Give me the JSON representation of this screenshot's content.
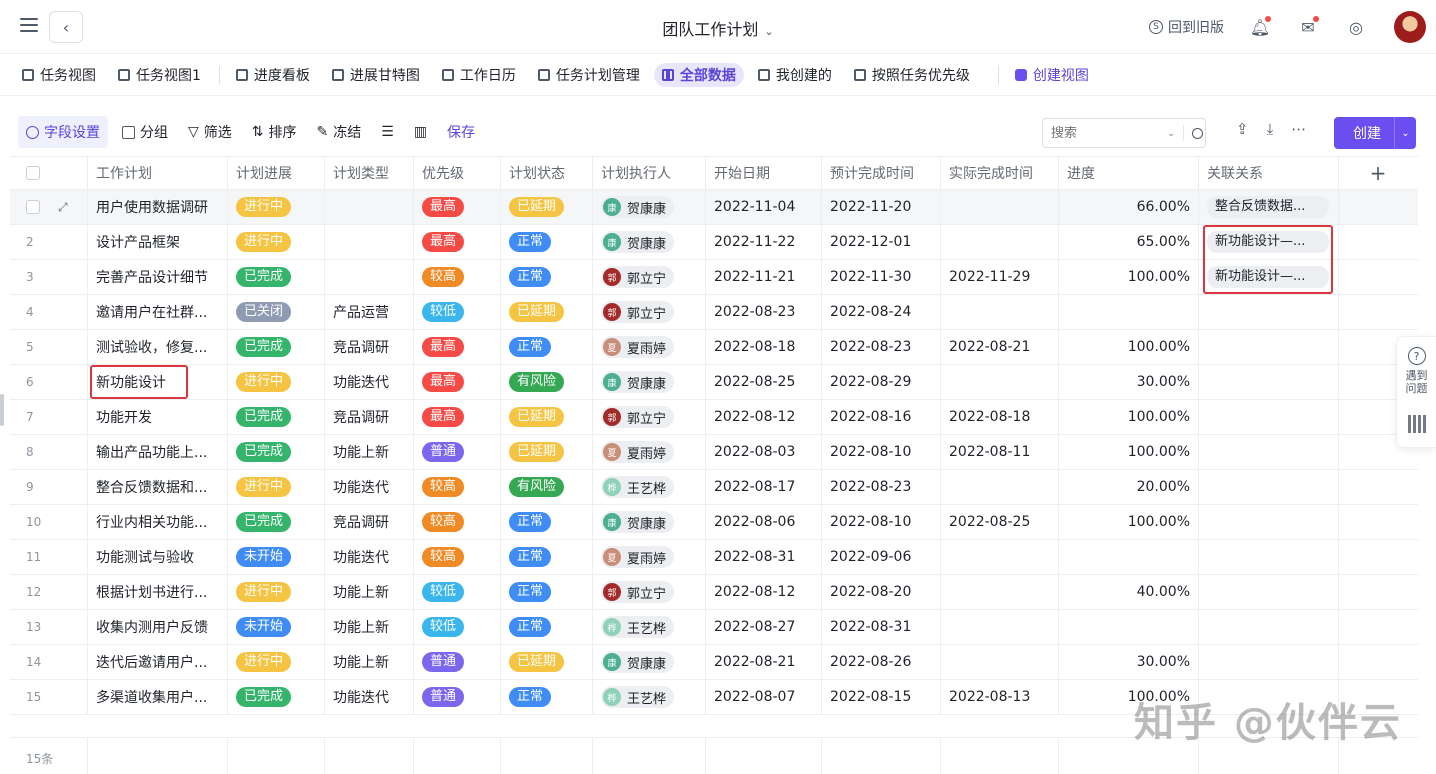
{
  "header": {
    "title": "团队工作计划",
    "old_version": "回到旧版"
  },
  "views": [
    {
      "label": "任务视图"
    },
    {
      "label": "任务视图1"
    },
    {
      "label": "进度看板"
    },
    {
      "label": "进展甘特图"
    },
    {
      "label": "工作日历"
    },
    {
      "label": "任务计划管理"
    },
    {
      "label": "全部数据",
      "active": true
    },
    {
      "label": "我创建的"
    },
    {
      "label": "按照任务优先级"
    }
  ],
  "create_view": "创建视图",
  "toolbar": {
    "field_settings": "字段设置",
    "group": "分组",
    "filter": "筛选",
    "sort": "排序",
    "freeze": "冻结",
    "save": "保存",
    "search_placeholder": "搜索",
    "create": "创建"
  },
  "columns": [
    "工作计划",
    "计划进展",
    "计划类型",
    "优先级",
    "计划状态",
    "计划执行人",
    "开始日期",
    "预计完成时间",
    "实际完成时间",
    "进度",
    "关联关系"
  ],
  "colors": {
    "进行中": "#f5c443",
    "已完成": "#34b56b",
    "已关闭": "#8f9bb3",
    "未开始": "#3f8cf5",
    "最高": "#f54a45",
    "较高": "#f08a24",
    "较低": "#3ab6ec",
    "普通": "#7b67ee",
    "已延期": "#f5c443",
    "正常": "#3f8cf5",
    "有风险": "#34a853",
    "accent": "#6b4ef0"
  },
  "people": {
    "贺康康": {
      "initial": "康",
      "color": "#4caf8f"
    },
    "郭立宁": {
      "initial": "郭",
      "color": "#a52a2a"
    },
    "夏雨婷": {
      "initial": "夏",
      "color": "#c98e7a"
    },
    "王艺桦": {
      "initial": "桦",
      "color": "#8fd1b9"
    }
  },
  "rows": [
    {
      "num": "",
      "name": "用户使用数据调研",
      "progress": "进行中",
      "type": "",
      "priority": "最高",
      "status": "已延期",
      "owner": "贺康康",
      "start": "2022-11-04",
      "due": "2022-11-20",
      "done": "",
      "pct": "66.00%",
      "rel": "整合反馈数据..."
    },
    {
      "num": "2",
      "name": "设计产品框架",
      "progress": "进行中",
      "type": "",
      "priority": "最高",
      "status": "正常",
      "owner": "贺康康",
      "start": "2022-11-22",
      "due": "2022-12-01",
      "done": "",
      "pct": "65.00%",
      "rel": "新功能设计—..."
    },
    {
      "num": "3",
      "name": "完善产品设计细节",
      "progress": "已完成",
      "type": "",
      "priority": "较高",
      "status": "正常",
      "owner": "郭立宁",
      "start": "2022-11-21",
      "due": "2022-11-30",
      "done": "2022-11-29",
      "pct": "100.00%",
      "rel": "新功能设计—..."
    },
    {
      "num": "4",
      "name": "邀请用户在社群...",
      "progress": "已关闭",
      "type": "产品运营",
      "priority": "较低",
      "status": "已延期",
      "owner": "郭立宁",
      "start": "2022-08-23",
      "due": "2022-08-24",
      "done": "",
      "pct": "",
      "rel": ""
    },
    {
      "num": "5",
      "name": "测试验收，修复...",
      "progress": "已完成",
      "type": "竞品调研",
      "priority": "最高",
      "status": "正常",
      "owner": "夏雨婷",
      "start": "2022-08-18",
      "due": "2022-08-23",
      "done": "2022-08-21",
      "pct": "100.00%",
      "rel": ""
    },
    {
      "num": "6",
      "name": "新功能设计",
      "progress": "进行中",
      "type": "功能迭代",
      "priority": "最高",
      "status": "有风险",
      "owner": "贺康康",
      "start": "2022-08-25",
      "due": "2022-08-29",
      "done": "",
      "pct": "30.00%",
      "rel": ""
    },
    {
      "num": "7",
      "name": "功能开发",
      "progress": "已完成",
      "type": "竞品调研",
      "priority": "最高",
      "status": "已延期",
      "owner": "郭立宁",
      "start": "2022-08-12",
      "due": "2022-08-16",
      "done": "2022-08-18",
      "pct": "100.00%",
      "rel": ""
    },
    {
      "num": "8",
      "name": "输出产品功能上...",
      "progress": "已完成",
      "type": "功能上新",
      "priority": "普通",
      "status": "已延期",
      "owner": "夏雨婷",
      "start": "2022-08-03",
      "due": "2022-08-10",
      "done": "2022-08-11",
      "pct": "100.00%",
      "rel": ""
    },
    {
      "num": "9",
      "name": "整合反馈数据和...",
      "progress": "进行中",
      "type": "功能迭代",
      "priority": "较高",
      "status": "有风险",
      "owner": "王艺桦",
      "start": "2022-08-17",
      "due": "2022-08-23",
      "done": "",
      "pct": "20.00%",
      "rel": ""
    },
    {
      "num": "10",
      "name": "行业内相关功能...",
      "progress": "已完成",
      "type": "竞品调研",
      "priority": "较高",
      "status": "正常",
      "owner": "贺康康",
      "start": "2022-08-06",
      "due": "2022-08-10",
      "done": "2022-08-25",
      "pct": "100.00%",
      "rel": ""
    },
    {
      "num": "11",
      "name": "功能测试与验收",
      "progress": "未开始",
      "type": "功能迭代",
      "priority": "较高",
      "status": "正常",
      "owner": "夏雨婷",
      "start": "2022-08-31",
      "due": "2022-09-06",
      "done": "",
      "pct": "",
      "rel": ""
    },
    {
      "num": "12",
      "name": "根据计划书进行...",
      "progress": "进行中",
      "type": "功能上新",
      "priority": "较低",
      "status": "正常",
      "owner": "郭立宁",
      "start": "2022-08-12",
      "due": "2022-08-20",
      "done": "",
      "pct": "40.00%",
      "rel": ""
    },
    {
      "num": "13",
      "name": "收集内测用户反馈",
      "progress": "未开始",
      "type": "功能上新",
      "priority": "较低",
      "status": "正常",
      "owner": "王艺桦",
      "start": "2022-08-27",
      "due": "2022-08-31",
      "done": "",
      "pct": "",
      "rel": ""
    },
    {
      "num": "14",
      "name": "迭代后邀请用户...",
      "progress": "进行中",
      "type": "功能上新",
      "priority": "普通",
      "status": "已延期",
      "owner": "贺康康",
      "start": "2022-08-21",
      "due": "2022-08-26",
      "done": "",
      "pct": "30.00%",
      "rel": ""
    },
    {
      "num": "15",
      "name": "多渠道收集用户...",
      "progress": "已完成",
      "type": "功能迭代",
      "priority": "普通",
      "status": "正常",
      "owner": "王艺桦",
      "start": "2022-08-07",
      "due": "2022-08-15",
      "done": "2022-08-13",
      "pct": "100.00%",
      "rel": ""
    }
  ],
  "footer": {
    "count": "15条"
  },
  "helper": {
    "label": "遇到问题"
  },
  "watermark": "知乎 @伙伴云"
}
